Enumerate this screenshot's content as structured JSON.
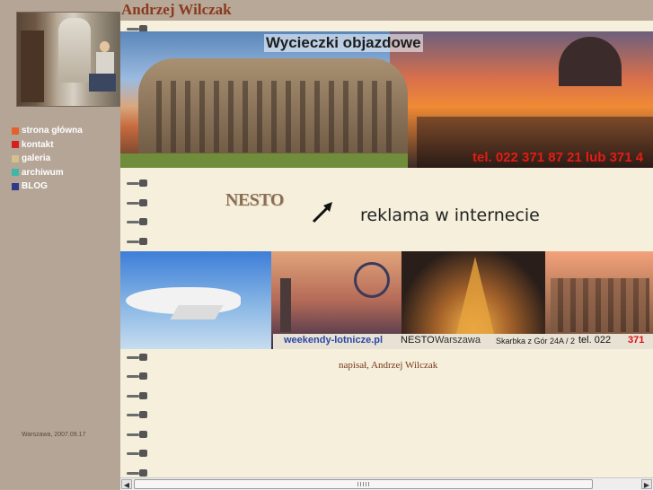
{
  "page": {
    "author_name": "Andrzej Wilczak"
  },
  "sidebar": {
    "nav": [
      {
        "label": "strona główna",
        "color": "#e2622a"
      },
      {
        "label": "kontakt",
        "color": "#d81e1e"
      },
      {
        "label": "galeria",
        "color": "#d6c089"
      },
      {
        "label": "archiwum",
        "color": "#3fb7a8"
      },
      {
        "label": "BLOG",
        "color": "#2e3a8a"
      }
    ],
    "date": "Warszawa, 2007.09.17"
  },
  "banner_top": {
    "heading": "Wycieczki objazdowe",
    "phone": "tel. 022 371 87 21 lub 371 4"
  },
  "ad": {
    "brand": "NESTO",
    "slogan": "reklama w internecie"
  },
  "banner_bottom": {
    "site": "weekendy-lotnicze.pl",
    "firm": "NESTO",
    "city": "Warszawa",
    "address": "Skarbka z Gór 24A / 2",
    "phone_prefix": "tel. 022",
    "phone_number": "371"
  },
  "post": {
    "signature": "napisał, Andrzej Wilczak"
  },
  "scroll": {
    "left_arrow": "◀",
    "right_arrow": "▶"
  }
}
